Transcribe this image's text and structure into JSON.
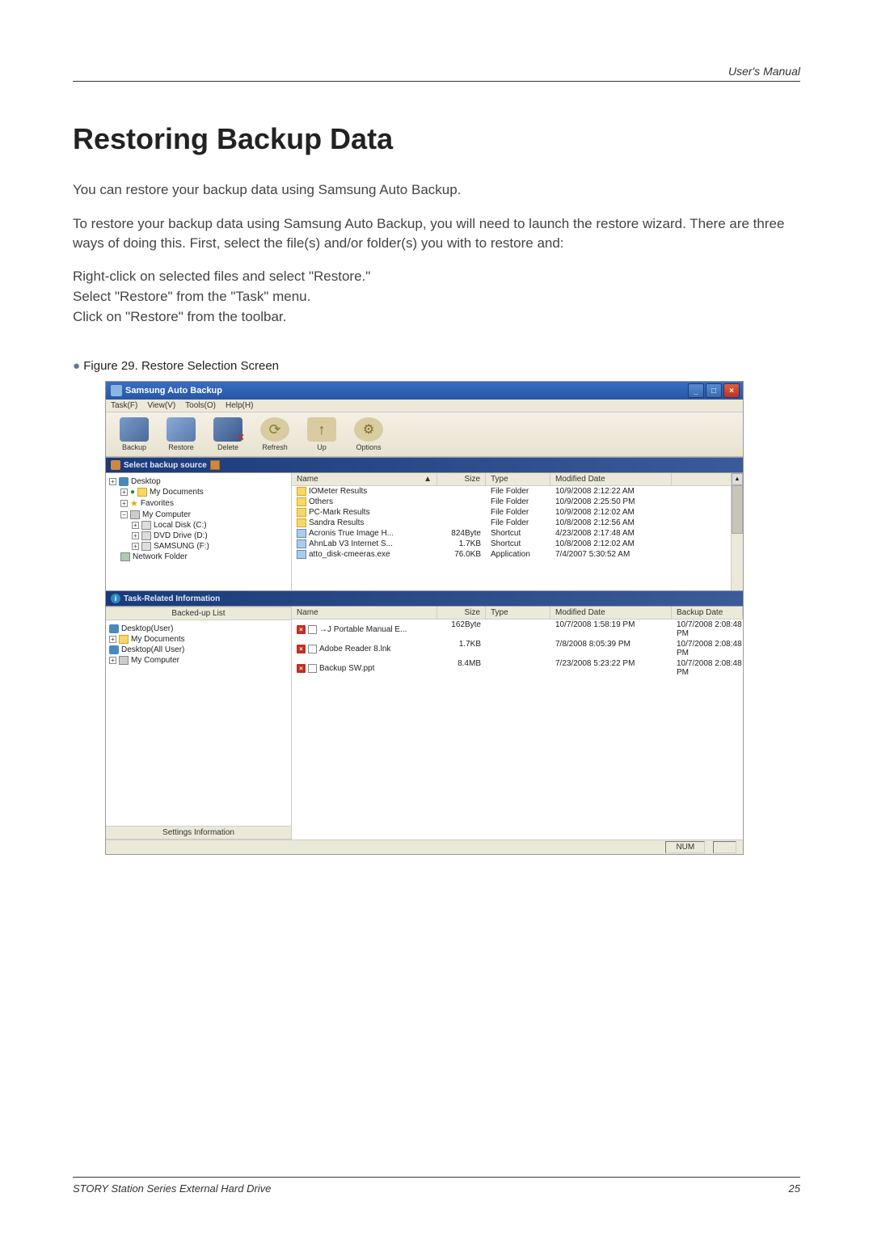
{
  "doc": {
    "header_right": "User's Manual",
    "title": "Restoring Backup Data",
    "para1": "You can restore your backup data using Samsung Auto Backup.",
    "para2": "To restore your backup data using Samsung Auto Backup, you will need to launch the restore wizard. There are three ways of doing this. First, select the file(s) and/or folder(s) you with to restore and:",
    "list1": "Right-click on selected files and select \"Restore.\"",
    "list2": "Select \"Restore\" from the \"Task\" menu.",
    "list3": "Click on \"Restore\" from the toolbar.",
    "figure_caption": "Figure 29. Restore Selection Screen",
    "footer_left": "STORY Station Series External Hard Drive",
    "footer_right": "25"
  },
  "app": {
    "title": "Samsung Auto Backup",
    "menu": {
      "task": "Task(F)",
      "view": "View(V)",
      "tools": "Tools(O)",
      "help": "Help(H)"
    },
    "toolbar": {
      "backup": "Backup",
      "restore": "Restore",
      "delete": "Delete",
      "refresh": "Refresh",
      "up": "Up",
      "options": "Options"
    },
    "section1": "Select backup source",
    "section2": "Task-Related Information",
    "tree": {
      "desktop": "Desktop",
      "mydocs": "My Documents",
      "favorites": "Favorites",
      "mycomputer": "My Computer",
      "localdisk": "Local Disk (C:)",
      "dvd": "DVD Drive (D:)",
      "samsung": "SAMSUNG (F:)",
      "network": "Network Folder"
    },
    "cols": {
      "name": "Name",
      "size": "Size",
      "type": "Type",
      "mdate": "Modified Date",
      "bdate": "Backup Date"
    },
    "sort_arrow": "▲",
    "top_rows": [
      {
        "name": "IOMeter Results",
        "size": "",
        "type": "File Folder",
        "mdate": "10/9/2008 2:12:22 AM"
      },
      {
        "name": "Others",
        "size": "",
        "type": "File Folder",
        "mdate": "10/9/2008 2:25:50 PM"
      },
      {
        "name": "PC-Mark Results",
        "size": "",
        "type": "File Folder",
        "mdate": "10/9/2008 2:12:02 AM"
      },
      {
        "name": "Sandra Results",
        "size": "",
        "type": "File Folder",
        "mdate": "10/8/2008 2:12:56 AM"
      },
      {
        "name": "Acronis True Image H...",
        "size": "824Byte",
        "type": "Shortcut",
        "mdate": "4/23/2008 2:17:48 AM"
      },
      {
        "name": "AhnLab V3 Internet S...",
        "size": "1.7KB",
        "type": "Shortcut",
        "mdate": "10/8/2008 2:12:02 AM"
      },
      {
        "name": "atto_disk-cmeeras.exe",
        "size": "76.0KB",
        "type": "Application",
        "mdate": "7/4/2007 5:30:52 AM"
      }
    ],
    "backed_tab": "Backed-up List",
    "backed_tree": {
      "desktop_user": "Desktop(User)",
      "mydocs": "My Documents",
      "desktop_all": "Desktop(All User)",
      "mycomputer": "My Computer"
    },
    "settings_tab": "Settings Information",
    "bottom_rows": [
      {
        "name": "→J Portable Manual E...",
        "size": "162Byte",
        "type": "",
        "mdate": "10/7/2008 1:58:19 PM",
        "bdate": "10/7/2008 2:08:48 PM"
      },
      {
        "name": "Adobe Reader 8.lnk",
        "size": "1.7KB",
        "type": "",
        "mdate": "7/8/2008 8:05:39 PM",
        "bdate": "10/7/2008 2:08:48 PM"
      },
      {
        "name": "Backup SW.ppt",
        "size": "8.4MB",
        "type": "",
        "mdate": "7/23/2008 5:23:22 PM",
        "bdate": "10/7/2008 2:08:48 PM"
      }
    ],
    "status_num": "NUM"
  }
}
